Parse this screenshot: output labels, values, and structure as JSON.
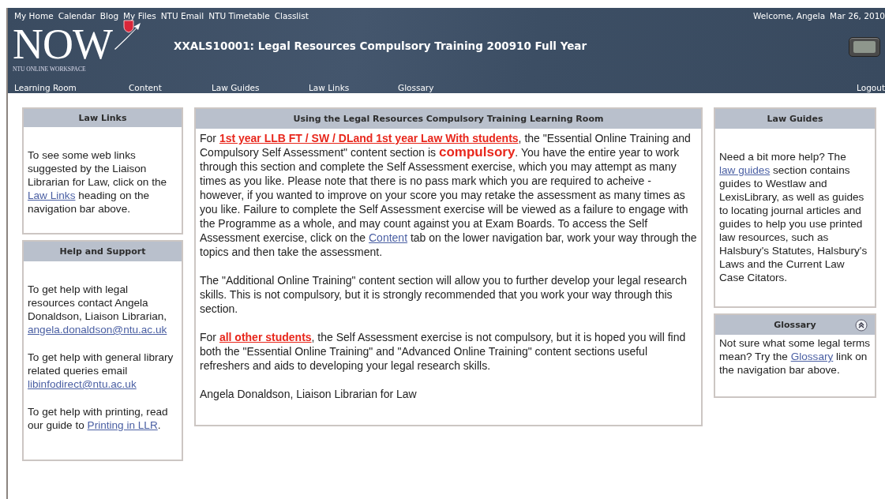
{
  "top_links": [
    "My Home",
    "Calendar",
    "Blog",
    "My Files",
    "NTU Email",
    "NTU Timetable",
    "Classlist"
  ],
  "welcome": "Welcome, Angela",
  "date": "Mar 26, 2010",
  "logo": {
    "text": "NOW",
    "subtitle": "NTU ONLINE WORKSPACE"
  },
  "course_title": "XXALS10001: Legal Resources Compulsory Training 200910 Full Year",
  "nav": [
    "Learning Room",
    "Content",
    "Law Guides",
    "Law Links",
    "Glossary"
  ],
  "logout": "Logout",
  "left_panels": [
    {
      "title": "Law Links",
      "paragraphs": [
        [
          {
            "kind": "text",
            "text": "To see some web links suggested by the Liaison Librarian for Law, click on the "
          },
          {
            "kind": "link",
            "text": "Law Links"
          },
          {
            "kind": "text",
            "text": " heading on the navigation bar above."
          }
        ]
      ]
    },
    {
      "title": "Help and Support",
      "paragraphs": [
        [
          {
            "kind": "text",
            "text": "To get help with legal resources contact Angela Donaldson, Liaison Librarian, "
          },
          {
            "kind": "link",
            "text": "angela.donaldson@ntu.ac.uk"
          }
        ],
        [
          {
            "kind": "text",
            "text": "To get help with general library related queries email "
          },
          {
            "kind": "link",
            "text": "libinfodirect@ntu.ac.uk"
          }
        ],
        [
          {
            "kind": "text",
            "text": "To get help with printing, read our guide to "
          },
          {
            "kind": "link",
            "text": "Printing in LLR"
          },
          {
            "kind": "text",
            "text": "."
          }
        ]
      ]
    }
  ],
  "main_panel": {
    "title": "Using the Legal Resources Compulsory Training Learning Room",
    "paragraphs": [
      [
        {
          "kind": "text",
          "text": "For "
        },
        {
          "kind": "alert_link",
          "text": "1st year LLB FT / SW / DLand 1st year Law With students"
        },
        {
          "kind": "text",
          "text": ", the \"Essential Online Training and Compulsory Self Assessment\" content section is "
        },
        {
          "kind": "alert",
          "text": "compulsory"
        },
        {
          "kind": "text",
          "text": ".  You have the entire year to work through this section and complete the Self Assessment exercise, which you may attempt as many times as you like.  Please note that there is no pass mark which you are required to acheive - however, if you wanted to improve on your score you may retake the assessment as many times as you like.  Failure to complete the Self Assessment exercise will be viewed as a failure to engage with the Programme as a whole, and may count against you at Exam Boards.  To access the Self Assessment exercise, click on the "
        },
        {
          "kind": "link",
          "text": "Content"
        },
        {
          "kind": "text",
          "text": " tab on the lower navigation bar, work your way through the topics and then take the assessment."
        }
      ],
      [
        {
          "kind": "text",
          "text": "The \"Additional Online Training\" content section will allow you to further develop your legal research skills.  This is not compulsory, but it is strongly recommended that you work your way through this section."
        }
      ],
      [
        {
          "kind": "text",
          "text": "For "
        },
        {
          "kind": "alert_link",
          "text": "all other students"
        },
        {
          "kind": "text",
          "text": ", the Self Assessment exercise is not compulsory, but it is hoped you will find both the \"Essential Online Training\" and \"Advanced Online Training\" content sections useful refreshers and aids to developing your legal research skills."
        }
      ],
      [
        {
          "kind": "text",
          "text": "Angela Donaldson, Liaison Librarian for Law"
        }
      ]
    ]
  },
  "law_guides_panel": {
    "title": "Law Guides",
    "paragraphs": [
      [
        {
          "kind": "text",
          "text": "Need a bit more help?  The "
        },
        {
          "kind": "link",
          "text": "law guides"
        },
        {
          "kind": "text",
          "text": " section contains guides to Westlaw and LexisLibrary, as well as guides to locating journal articles and guides to help you use printed law resources, such as Halsbury's Statutes, Halsbury's Laws and the Current Law Case Citators."
        }
      ]
    ]
  },
  "glossary_panel": {
    "title": "Glossary",
    "expanded": true,
    "paragraphs": [
      [
        {
          "kind": "text",
          "text": "Not sure what some legal terms mean?  Try the "
        },
        {
          "kind": "link",
          "text": "Glossary"
        },
        {
          "kind": "text",
          "text": " link on the navigation bar above."
        }
      ]
    ]
  }
}
